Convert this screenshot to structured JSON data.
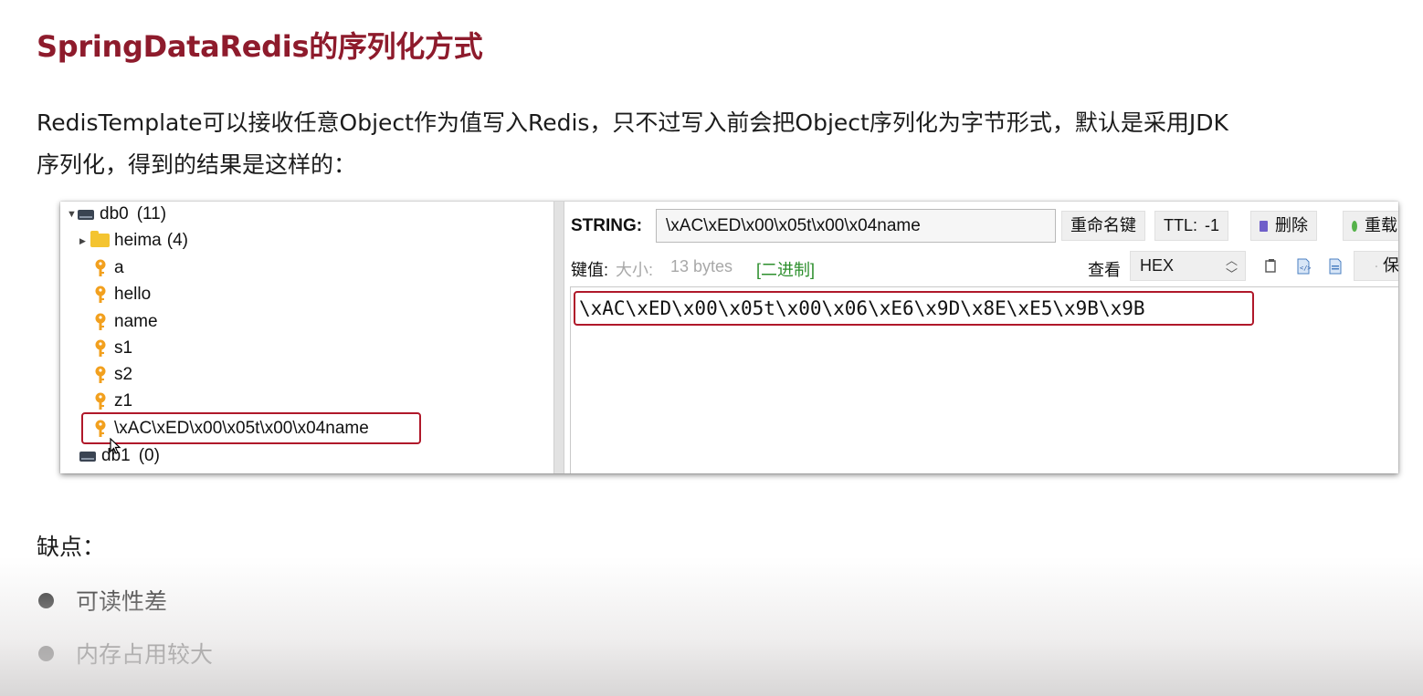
{
  "title": "SpringDataRedis的序列化方式",
  "paragraph": {
    "line1": "RedisTemplate可以接收任意Object作为值写入Redis，只不过写入前会把Object序列化为字节形式，默认是采用JDK",
    "line2": "序列化，得到的结果是这样的："
  },
  "tree": {
    "db0": {
      "name": "db0",
      "count": "(11)"
    },
    "folder": {
      "name": "heima",
      "count": "(4)"
    },
    "keys": [
      "a",
      "hello",
      "name",
      "s1",
      "s2",
      "z1"
    ],
    "selected_key": "\\xAC\\xED\\x00\\x05t\\x00\\x04name",
    "db1": {
      "name": "db1",
      "count": "(0)"
    }
  },
  "detail": {
    "type_label": "STRING:",
    "key_value": "\\xAC\\xED\\x00\\x05t\\x00\\x04name",
    "rename_button": "重命名键",
    "ttl_label": "TTL:",
    "ttl_value": "-1",
    "delete_button": "删除",
    "reload_button": "重载",
    "value_label": "键值:",
    "size_label": "大小:",
    "size_value": "13 bytes",
    "binary_tag": "[二进制]",
    "view_label": "查看",
    "view_mode": "HEX",
    "save_partial": "保",
    "value": "\\xAC\\xED\\x00\\x05t\\x00\\x06\\xE6\\x9D\\x8E\\xE5\\x9B\\x9B"
  },
  "cons": {
    "title": "缺点：",
    "items": [
      "可读性差",
      "内存占用较大"
    ]
  },
  "colors": {
    "title": "#8e1b2c",
    "highlight_border": "#b0182a",
    "binary_tag": "#2c8f2c",
    "key_icon": "#f2a01e",
    "folder": "#f4c430"
  },
  "icons": [
    "db-icon",
    "folder-icon",
    "key-icon",
    "trash-icon",
    "reload-icon",
    "copy-icon",
    "code-icon",
    "doc-icon",
    "save-icon",
    "expand-triangle-icon",
    "collapse-triangle-icon",
    "mouse-cursor-icon"
  ]
}
